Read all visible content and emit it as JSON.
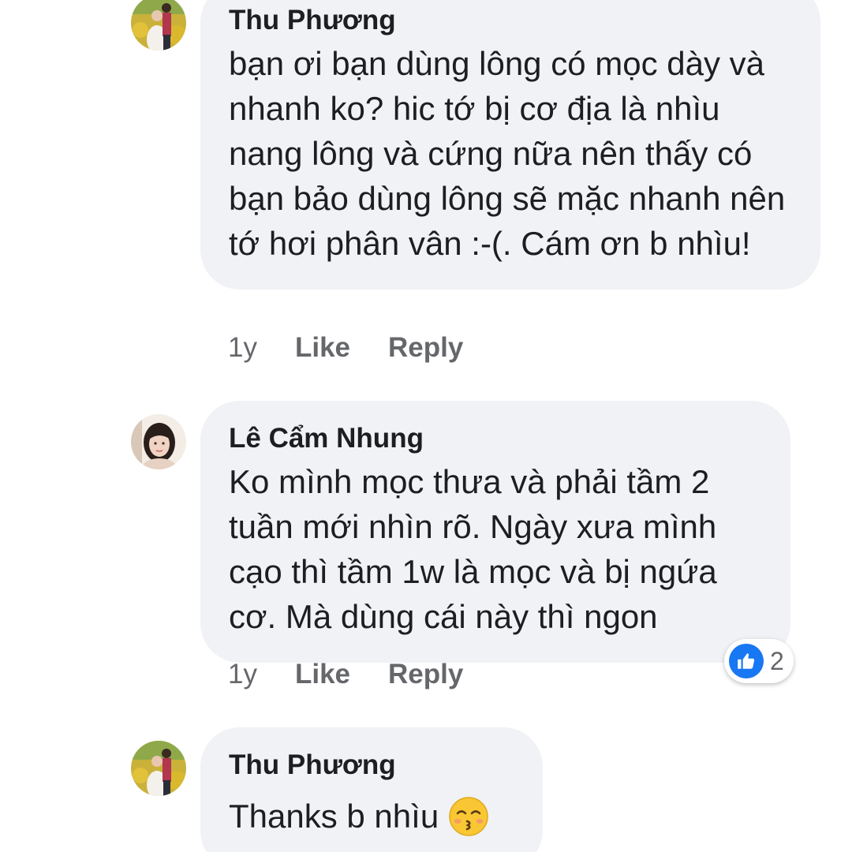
{
  "comments": [
    {
      "author": "Thu Phương",
      "text": "bạn ơi bạn dùng lông có mọc dày và nhanh ko? hic tớ bị cơ địa là nhìu nang lông và cứng nữa nên thấy có bạn bảo dùng lông sẽ mặc nhanh nên tớ hơi phân vân :-(. Cám ơn b nhìu!",
      "time": "1y",
      "like_label": "Like",
      "reply_label": "Reply"
    },
    {
      "author": "Lê Cẩm Nhung",
      "text": "Ko mình mọc thưa và phải tầm 2 tuần mới nhìn rõ. Ngày xưa mình cạo thì tầm 1w là mọc và bị ngứa cơ. Mà dùng cái này thì ngon",
      "time": "1y",
      "like_label": "Like",
      "reply_label": "Reply",
      "reaction": {
        "icon": "thumbs-up-icon",
        "count": "2",
        "color": "#1877f2"
      }
    },
    {
      "author": "Thu Phương",
      "text": "Thanks b nhìu",
      "emoji": "kissing-face-emoji"
    }
  ],
  "colors": {
    "bubble": "#f0f2f5",
    "text": "#1c1e21",
    "meta": "#65676b",
    "like_blue": "#1877f2"
  }
}
